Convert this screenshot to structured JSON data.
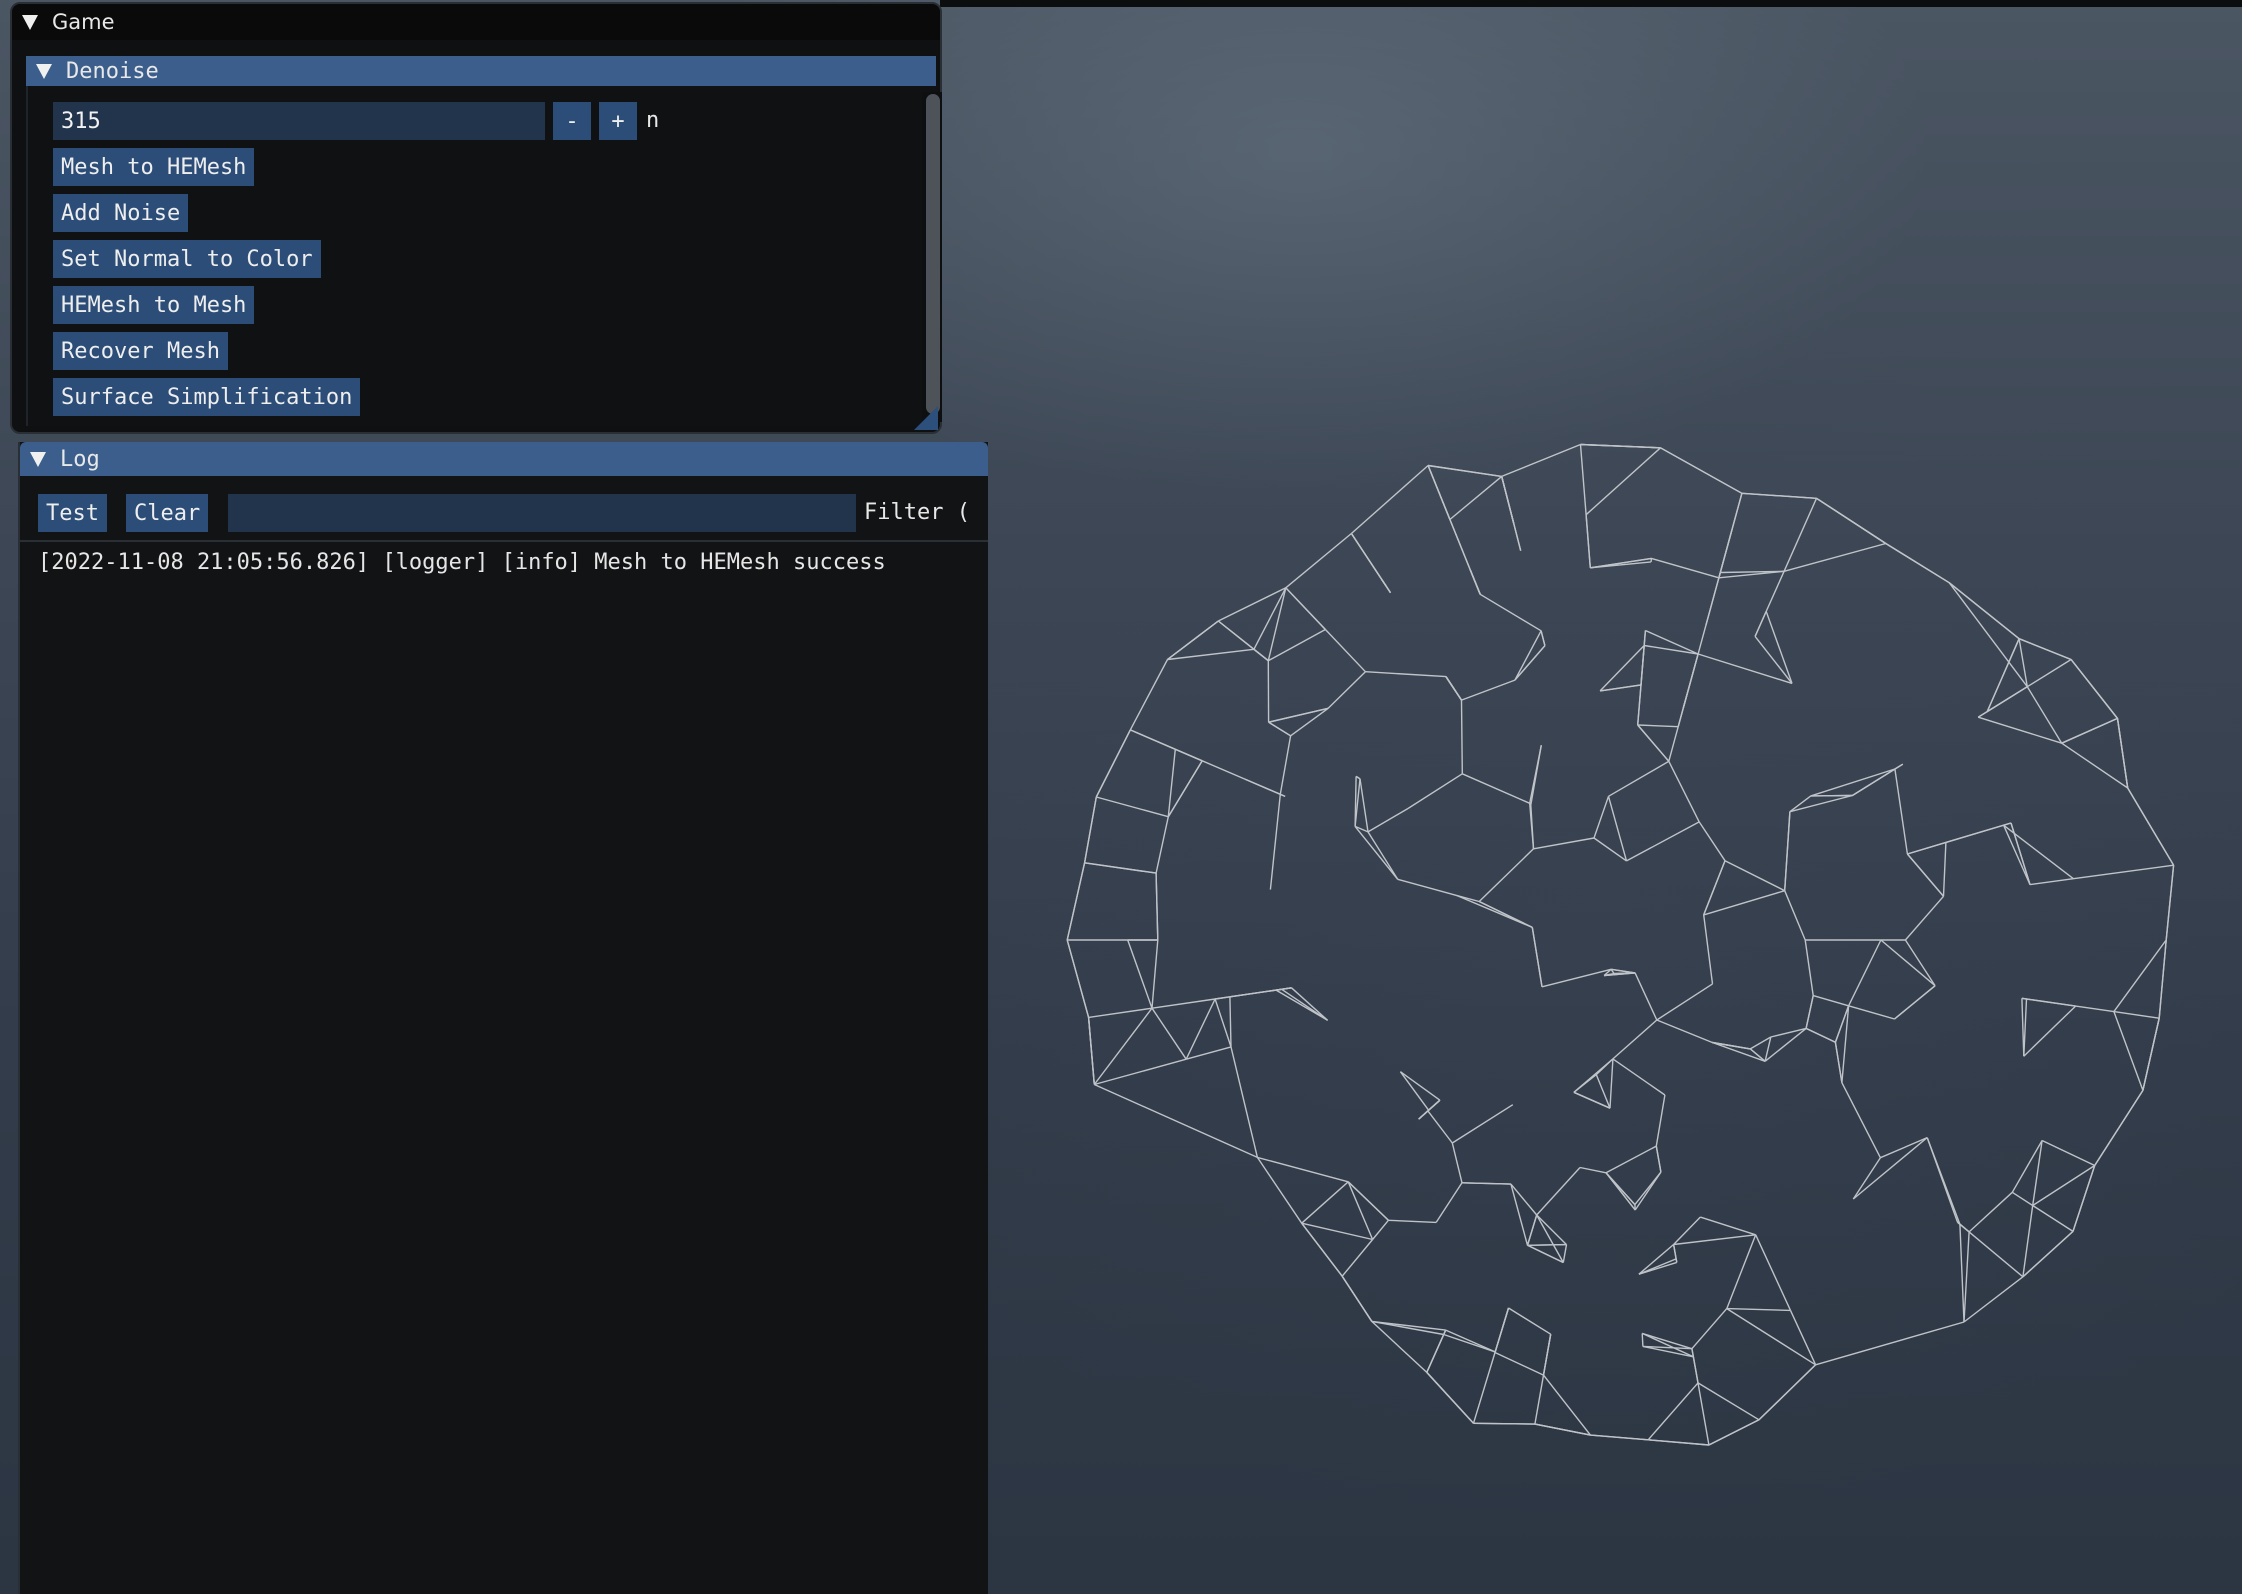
{
  "game_window": {
    "title": "Game",
    "denoise_section": {
      "header": "Denoise",
      "int_input": {
        "value": "315",
        "minus": "-",
        "plus": "+",
        "label": "n"
      },
      "buttons": [
        "Mesh to HEMesh",
        "Add Noise",
        "Set Normal to Color",
        "HEMesh to Mesh",
        "Recover Mesh",
        "Surface Simplification"
      ]
    }
  },
  "log_window": {
    "title": "Log",
    "test_label": "Test",
    "clear_label": "Clear",
    "filter_value": "",
    "filter_label": "Filter (",
    "lines": [
      "[2022-11-08 21:05:56.826] [logger] [info] Mesh to HEMesh success"
    ]
  },
  "colors": {
    "accent": "#3c5e8c",
    "button": "#2b4d78",
    "field": "#22344c",
    "panel_bg": "#111315",
    "wireframe": "#cfd2d6"
  },
  "icons": {
    "collapse": "triangle-down-icon"
  }
}
